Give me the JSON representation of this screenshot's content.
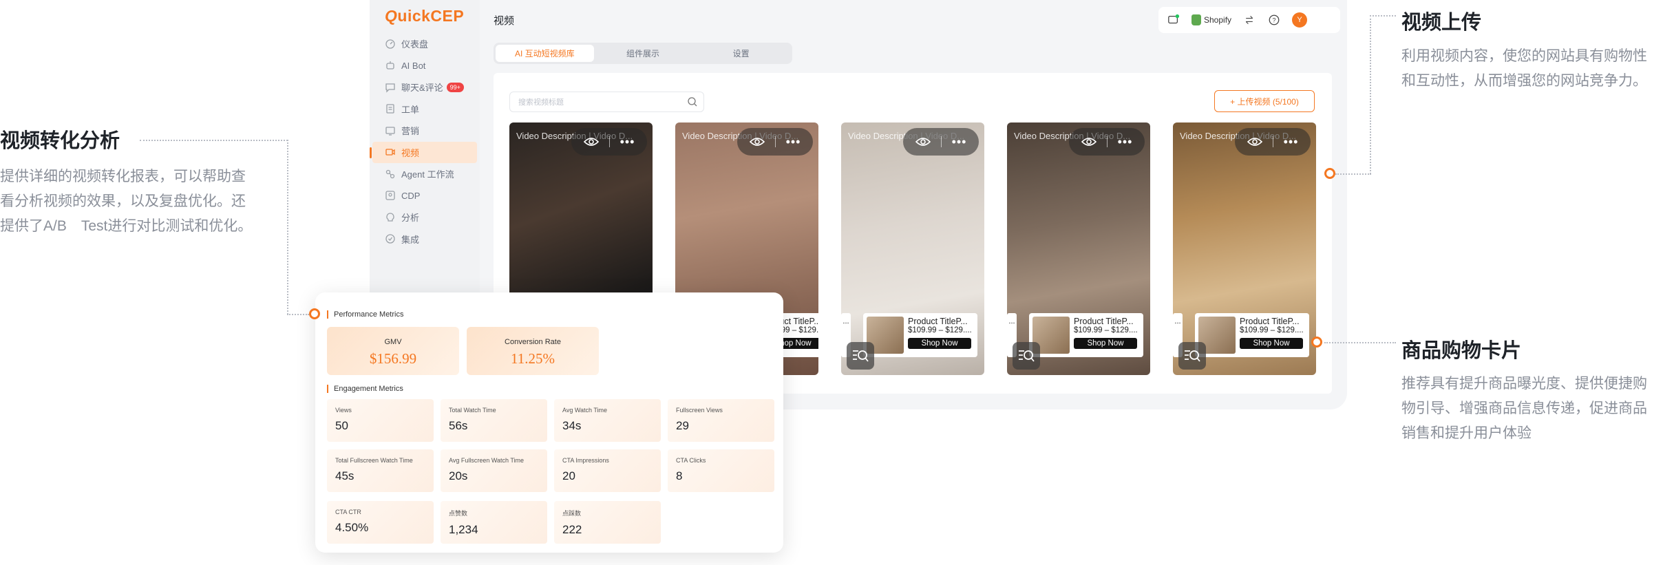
{
  "app": {
    "logo": "QuickCEP",
    "logo_q": "Q",
    "logo_rest": "uickCEP",
    "page_title": "视频",
    "nav": [
      {
        "label": "仪表盘",
        "icon": "dashboard-icon"
      },
      {
        "label": "AI Bot",
        "icon": "bot-icon"
      },
      {
        "label": "聊天&评论",
        "icon": "chat-icon",
        "badge": "99+"
      },
      {
        "label": "工单",
        "icon": "ticket-icon"
      },
      {
        "label": "营销",
        "icon": "marketing-icon"
      },
      {
        "label": "视频",
        "icon": "video-icon",
        "active": true
      },
      {
        "label": "Agent 工作流",
        "icon": "workflow-icon"
      },
      {
        "label": "CDP",
        "icon": "cdp-icon"
      },
      {
        "label": "分析",
        "icon": "analytics-icon"
      },
      {
        "label": "集成",
        "icon": "integration-icon"
      }
    ],
    "topbar": {
      "shopify": "Shopify",
      "avatar": "Y"
    },
    "tabs": [
      "AI 互动短视频库",
      "组件展示",
      "设置"
    ],
    "search_placeholder": "搜索视频标题",
    "upload_label": "+ 上传视频 (5/100)",
    "video_desc": "Video Description | Video D...",
    "product": {
      "name": "Product TitleP...",
      "price": "$109.99 – $129....",
      "shop": "Shop Now"
    },
    "stub_text": "...",
    "accent": "#f47721"
  },
  "metrics": {
    "performance_title": "Performance Metrics",
    "gmv_label": "GMV",
    "gmv_value": "$156.99",
    "cr_label": "Conversion Rate",
    "cr_value": "11.25%",
    "engagement_title": "Engagement Metrics",
    "items": [
      {
        "label": "Views",
        "value": "50"
      },
      {
        "label": "Total Watch Time",
        "value": "56s"
      },
      {
        "label": "Avg Watch Time",
        "value": "34s"
      },
      {
        "label": "Fullscreen Views",
        "value": "29"
      },
      {
        "label": "Total Fullscreen Watch Time",
        "value": "45s"
      },
      {
        "label": "Avg Fullscreen Watch Time",
        "value": "20s"
      },
      {
        "label": "CTA Impressions",
        "value": "20"
      },
      {
        "label": "CTA Clicks",
        "value": "8"
      },
      {
        "label": "CTA CTR",
        "value": "4.50%"
      },
      {
        "label": "点赞数",
        "value": "1,234"
      },
      {
        "label": "点踩数",
        "value": "222"
      }
    ]
  },
  "annotations": {
    "left_title": "视频转化分析",
    "left_text": "提供详细的视频转化报表，可以帮助查看分析视频的效果，以及复盘优化。还提供了A/B　Test进行对比测试和优化。",
    "upload_title": "视频上传",
    "upload_text": "利用视频内容，使您的网站具有购物性和互动性，从而增强您的网站竞争力。",
    "card_title": "商品购物卡片",
    "card_text": "推荐具有提升商品曝光度、提供便捷购物引导、增强商品信息传递，促进商品销售和提升用户体验"
  }
}
